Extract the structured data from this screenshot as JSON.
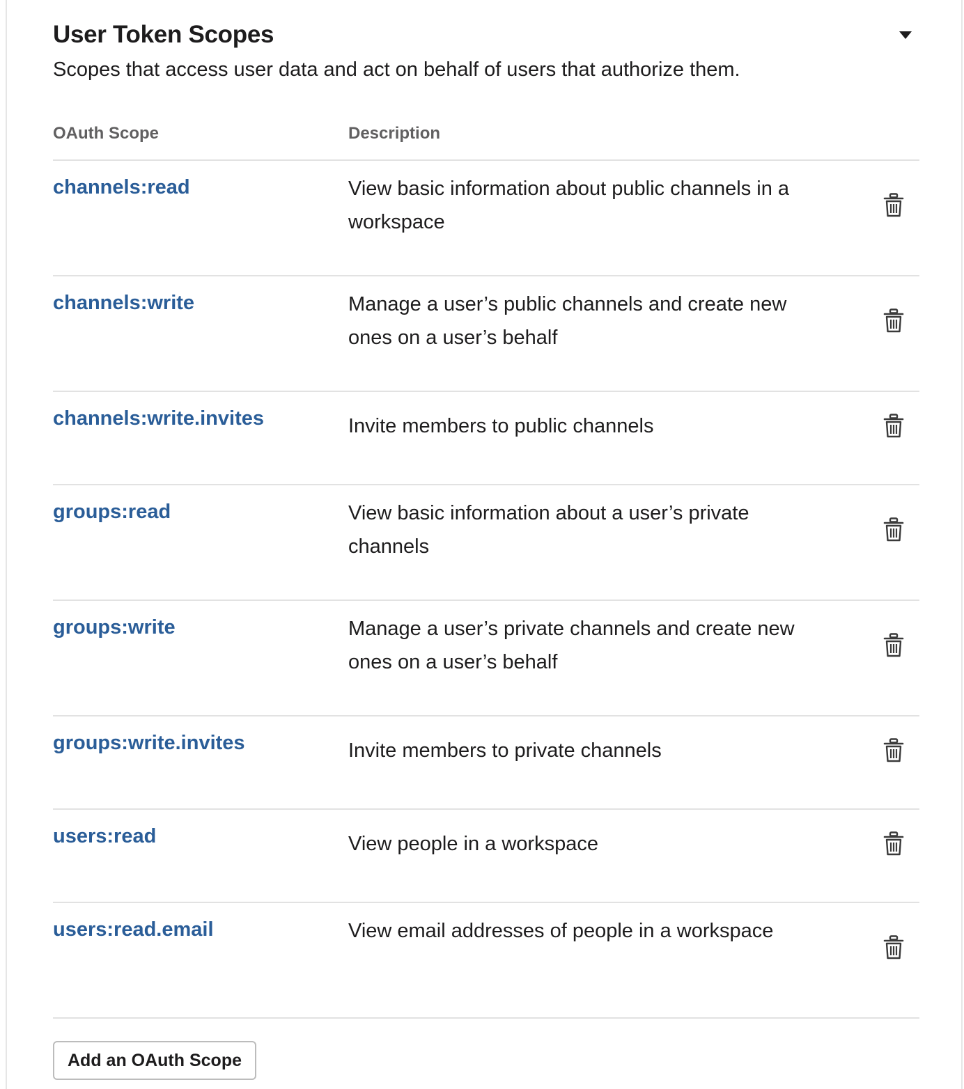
{
  "section": {
    "title": "User Token Scopes",
    "subtitle": "Scopes that access user data and act on behalf of users that authorize them.",
    "collapse_icon": "caret-down-icon"
  },
  "table": {
    "headers": {
      "scope": "OAuth Scope",
      "description": "Description"
    },
    "rows": [
      {
        "scope": "channels:read",
        "description": "View basic information about public channels in a workspace",
        "action_icon": "trash-icon"
      },
      {
        "scope": "channels:write",
        "description": "Manage a user’s public channels and create new ones on a user’s behalf",
        "action_icon": "trash-icon"
      },
      {
        "scope": "channels:write.invites",
        "description": "Invite members to public channels",
        "action_icon": "trash-icon"
      },
      {
        "scope": "groups:read",
        "description": "View basic information about a user’s private channels",
        "action_icon": "trash-icon"
      },
      {
        "scope": "groups:write",
        "description": "Manage a user’s private channels and create new ones on a user’s behalf",
        "action_icon": "trash-icon"
      },
      {
        "scope": "groups:write.invites",
        "description": "Invite members to private channels",
        "action_icon": "trash-icon"
      },
      {
        "scope": "users:read",
        "description": "View people in a workspace",
        "action_icon": "trash-icon"
      },
      {
        "scope": "users:read.email",
        "description": "View email addresses of people in a workspace",
        "action_icon": "trash-icon"
      }
    ]
  },
  "add_button_label": "Add an OAuth Scope",
  "colors": {
    "link": "#2a5d98",
    "text": "#1d1c1d",
    "muted": "#616061",
    "divider": "#e2e2e2"
  }
}
